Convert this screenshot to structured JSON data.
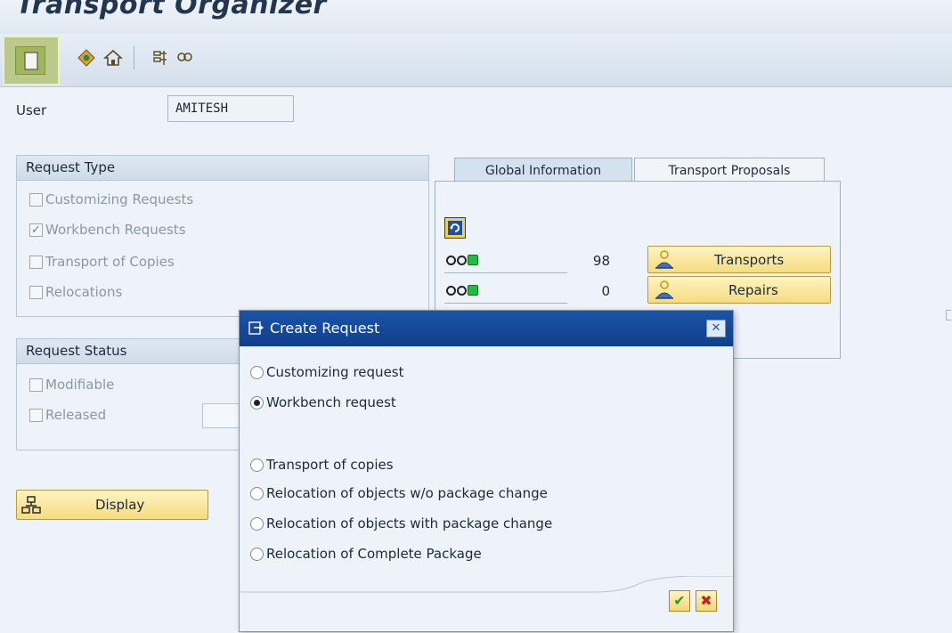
{
  "app": {
    "title": "Transport Organizer"
  },
  "user": {
    "label": "User",
    "value": "AMITESH"
  },
  "request_type": {
    "title": "Request Type",
    "items": [
      {
        "label": "Customizing Requests",
        "checked": false
      },
      {
        "label": "Workbench Requests",
        "checked": true
      },
      {
        "label": "Transport of Copies",
        "checked": false
      },
      {
        "label": "Relocations",
        "checked": false
      }
    ]
  },
  "request_status": {
    "title": "Request Status",
    "items": [
      {
        "label": "Modifiable",
        "checked": false
      },
      {
        "label": "Released",
        "checked": false
      }
    ]
  },
  "display_button": {
    "label": "Display"
  },
  "tabs": [
    {
      "label": "Global Information",
      "active": true
    },
    {
      "label": "Transport Proposals",
      "active": false
    }
  ],
  "global_info": {
    "rows": [
      {
        "count": "98",
        "button": "Transports"
      },
      {
        "count": "0",
        "button": "Repairs"
      }
    ]
  },
  "dialog": {
    "title": "Create Request",
    "options": [
      {
        "label": "Customizing request",
        "selected": false
      },
      {
        "label": "Workbench request",
        "selected": true
      },
      {
        "label": "Transport of copies",
        "selected": false
      },
      {
        "label": "Relocation of objects w/o package change",
        "selected": false
      },
      {
        "label": "Relocation of objects with package change",
        "selected": false
      },
      {
        "label": "Relocation of Complete Package",
        "selected": false
      }
    ],
    "ok_icon": "checkmark-icon",
    "cancel_icon": "cancel-x-icon"
  },
  "colors": {
    "dialog_header": "#1c54a8",
    "button_yellow": "#f5dc7e",
    "status_green": "#1fbf3b"
  }
}
